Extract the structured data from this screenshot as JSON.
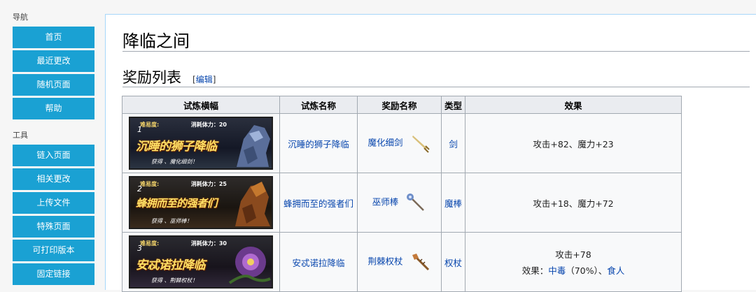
{
  "sidebar": {
    "nav_heading": "导航",
    "nav_items": [
      "首页",
      "最近更改",
      "随机页面",
      "帮助"
    ],
    "tools_heading": "工具",
    "tools_items": [
      "链入页面",
      "相关更改",
      "上传文件",
      "特殊页面",
      "可打印版本",
      "固定链接"
    ]
  },
  "page": {
    "title": "降临之间",
    "section_title": "奖励列表",
    "edit_open": "[",
    "edit_label": "编辑",
    "edit_close": "]"
  },
  "table": {
    "headers": [
      "试炼横幅",
      "试炼名称",
      "奖励名称",
      "类型",
      "效果"
    ],
    "rows": [
      {
        "banner": {
          "difficulty_label": "难易度:",
          "difficulty": "1",
          "stamina": "消耗体力：20",
          "title": "沉睡的狮子降临",
          "sub": "获得 、魔化细剑！"
        },
        "trial_name": "沉睡的狮子降临",
        "reward_name": "魔化细剑",
        "reward_icon": "rapier-icon",
        "type": "剑",
        "effect": "攻击+82、魔力+23"
      },
      {
        "banner": {
          "difficulty_label": "难易度:",
          "difficulty": "2",
          "stamina": "消耗体力：25",
          "title": "蜂拥而至的强者们",
          "sub": "获得 、巫师棒！"
        },
        "trial_name": "蜂拥而至的强者们",
        "reward_name": "巫师棒",
        "reward_icon": "wizard-rod-icon",
        "type": "魔棒",
        "effect": "攻击+18、魔力+72"
      },
      {
        "banner": {
          "difficulty_label": "难易度:",
          "difficulty": "3",
          "stamina": "消耗体力：30",
          "title": "安忒诺拉降临",
          "sub": "获得 、荆棘权杖！"
        },
        "trial_name": "安忒诺拉降临",
        "reward_name": "荆棘权杖",
        "reward_icon": "thorn-staff-icon",
        "type": "权杖",
        "effect_line1": "攻击+78",
        "effect_prefix": "效果：",
        "effect_link1": "中毒",
        "effect_mid": "（70%）、",
        "effect_link2": "食人"
      }
    ]
  },
  "colors": {
    "nav_button": "#1aa1d3",
    "link": "#0645ad",
    "header_bg": "#eaecf0"
  }
}
